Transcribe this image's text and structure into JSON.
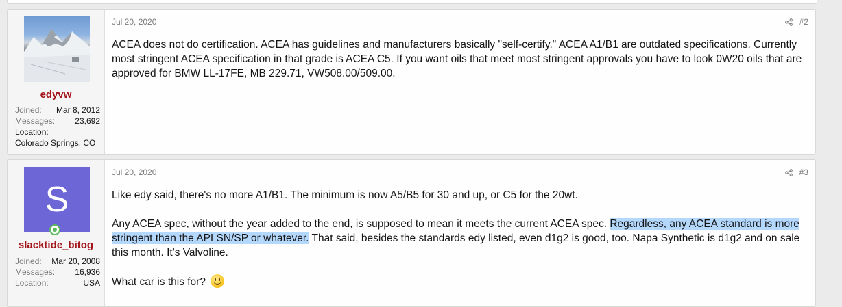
{
  "posts": [
    {
      "date": "Jul 20, 2020",
      "number": "#2",
      "user": {
        "name": "edyvw",
        "joined_label": "Joined:",
        "joined": "Mar 8, 2012",
        "messages_label": "Messages:",
        "messages": "23,692",
        "location_label": "Location:",
        "location": "Colorado Springs, CO"
      },
      "body": [
        "ACEA does not do certification. ACEA has guidelines and manufacturers basically \"self-certify.\" ACEA A1/B1 are outdated specifications. Currently most stringent ACEA specification in that grade is ACEA C5. If you want oils that meet most stringent approvals you have to look 0W20 oils that are approved for BMW LL-17FE, MB 229.71, VW508.00/509.00."
      ]
    },
    {
      "date": "Jul 20, 2020",
      "number": "#3",
      "user": {
        "avatar_letter": "S",
        "name": "slacktide_bitog",
        "joined_label": "Joined:",
        "joined": "Mar 20, 2008",
        "messages_label": "Messages:",
        "messages": "16,936",
        "location_label": "Location:",
        "location": "USA"
      },
      "body_p1": "Like edy said, there's no more A1/B1. The minimum is now A5/B5 for 30 and up, or C5 for the 20wt.",
      "body_p2_before": "Any ACEA spec, without the year added to the end, is supposed to mean it meets the current ACEA spec. ",
      "body_p2_selected": "Regardless, any ACEA standard is more stringent than the API SN/SP or whatever.",
      "body_p2_after": " That said, besides the standards edy listed, even d1g2 is good, too. Napa Synthetic is d1g2 and on sale this month. It's Valvoline.",
      "body_p3": "What car is this for?"
    }
  ],
  "colors": {
    "username": "#a3161c",
    "avatar_bg": "#6c66d6",
    "selection": "#b4d7fc",
    "online": "#5cb85c"
  },
  "icons": [
    "share-icon",
    "online-status-icon",
    "smile-emoji-icon"
  ]
}
